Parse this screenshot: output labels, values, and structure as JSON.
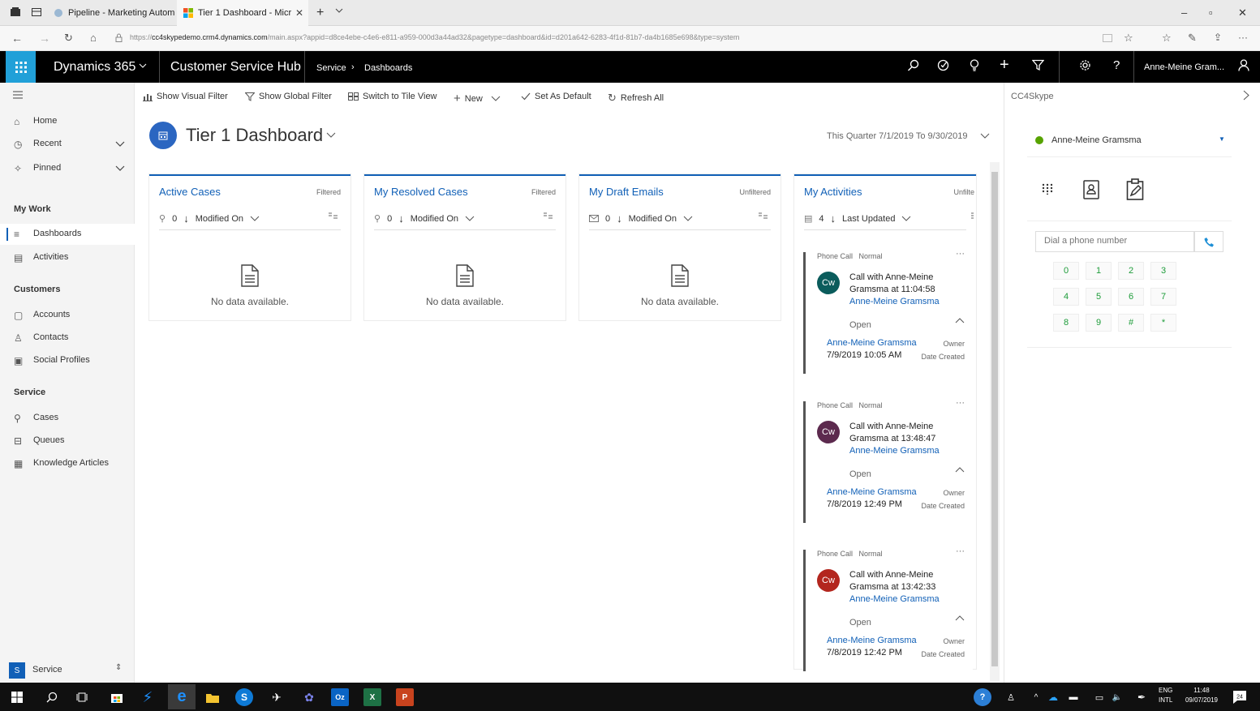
{
  "browser": {
    "tabs": [
      {
        "label": "Pipeline - Marketing Autom"
      },
      {
        "label": "Tier 1 Dashboard - Micr"
      }
    ],
    "url_prefix": "https://",
    "url_host": "cc4skypedemo.crm4.dynamics.com",
    "url_path": "/main.aspx?appid=d8ce4ebe-c4e6-e811-a959-000d3a44ad32&pagetype=dashboard&id=d201a642-6283-4f1d-81b7-da4b1685e698&type=system"
  },
  "topbar": {
    "product": "Dynamics 365",
    "app": "Customer Service Hub",
    "breadcrumb": [
      "Service",
      "Dashboards"
    ],
    "user": "Anne-Meine Gram..."
  },
  "commands": {
    "show_visual_filter": "Show Visual Filter",
    "show_global_filter": "Show Global Filter",
    "switch_tile": "Switch to Tile View",
    "new": "New",
    "set_default": "Set As Default",
    "refresh": "Refresh All"
  },
  "leftnav": {
    "home": "Home",
    "recent": "Recent",
    "pinned": "Pinned",
    "group_mywork": "My Work",
    "dashboards": "Dashboards",
    "activities": "Activities",
    "group_customers": "Customers",
    "accounts": "Accounts",
    "contacts": "Contacts",
    "social": "Social Profiles",
    "group_service": "Service",
    "cases": "Cases",
    "queues": "Queues",
    "kb": "Knowledge Articles",
    "area_letter": "S",
    "area": "Service"
  },
  "dashboard": {
    "title": "Tier 1 Dashboard",
    "period": "This Quarter 7/1/2019 To 9/30/2019",
    "tiles": [
      {
        "title": "Active Cases",
        "filter": "Filtered",
        "count": "0",
        "sort": "Modified On",
        "empty": "No data available."
      },
      {
        "title": "My Resolved Cases",
        "filter": "Filtered",
        "count": "0",
        "sort": "Modified On",
        "empty": "No data available."
      },
      {
        "title": "My Draft Emails",
        "filter": "Unfiltered",
        "count": "0",
        "sort": "Modified On",
        "empty": "No data available."
      }
    ],
    "activities": {
      "title": "My Activities",
      "filter": "Unfilte",
      "count": "4",
      "sort": "Last Updated",
      "items": [
        {
          "type": "Phone Call",
          "priority": "Normal",
          "initials": "Cw",
          "avatar_color": "#0b5c5c",
          "title": "Call with Anne-Meine Gramsma at 11:04:58",
          "regarding": "Anne-Meine Gramsma",
          "status": "Open",
          "owner": "Anne-Meine Gramsma",
          "owner_label": "Owner",
          "date": "7/9/2019 10:05 AM",
          "date_label": "Date Created"
        },
        {
          "type": "Phone Call",
          "priority": "Normal",
          "initials": "Cw",
          "avatar_color": "#5c2a4e",
          "title": "Call with Anne-Meine Gramsma at 13:48:47",
          "regarding": "Anne-Meine Gramsma",
          "status": "Open",
          "owner": "Anne-Meine Gramsma",
          "owner_label": "Owner",
          "date": "7/8/2019 12:49 PM",
          "date_label": "Date Created"
        },
        {
          "type": "Phone Call",
          "priority": "Normal",
          "initials": "Cw",
          "avatar_color": "#b3261e",
          "title": "Call with Anne-Meine Gramsma at 13:42:33",
          "regarding": "Anne-Meine Gramsma",
          "status": "Open",
          "owner": "Anne-Meine Gramsma",
          "owner_label": "Owner",
          "date": "7/8/2019 12:42 PM",
          "date_label": "Date Created"
        }
      ]
    }
  },
  "skype": {
    "title": "CC4Skype",
    "user": "Anne-Meine Gramsma",
    "status_color": "#57a300",
    "dial_placeholder": "Dial a phone number",
    "keys": [
      "0",
      "1",
      "2",
      "3",
      "4",
      "5",
      "6",
      "7",
      "8",
      "9",
      "#",
      "*"
    ]
  },
  "taskbar": {
    "lang1": "ENG",
    "lang2": "INTL",
    "time": "11:48",
    "date": "09/07/2019",
    "notif": "24"
  }
}
